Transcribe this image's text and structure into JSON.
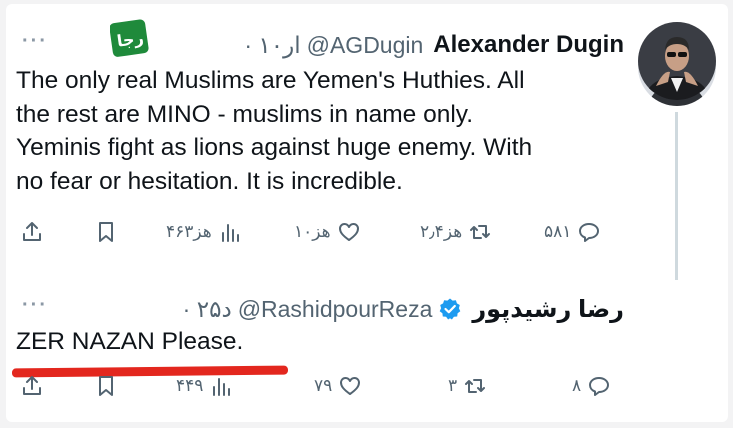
{
  "tweet1": {
    "display_name": "Alexander Dugin",
    "handle": "@AGDugin",
    "time": "· ۱۰ار",
    "body": "The only real Muslims are Yemen's Huthies. All\nthe rest are MINO - muslims in name only.\nYeminis fight as lions against huge enemy. With\nno fear or hesitation. It is incredible.",
    "more_label": "···",
    "badge_text": "رجا",
    "actions": {
      "replies": "۵۸۱",
      "reposts": "۲٫۴هز",
      "likes": "۱۰هز",
      "views": "۴۶۳هز"
    }
  },
  "tweet2": {
    "display_name": "رضا رشیدپور",
    "handle": "@RashidpourReza",
    "time": "· ۲۵د",
    "body": "ZER NAZAN Please.",
    "more_label": "···",
    "actions": {
      "replies": "۸",
      "reposts": "۳",
      "likes": "۷۹",
      "views": "۴۴۹"
    }
  },
  "colors": {
    "text": "#0f1419",
    "muted": "#536471",
    "verified": "#1d9bf0",
    "underline": "#e3271e",
    "badge": "#1f8a3b"
  },
  "icons": [
    "share-icon",
    "bookmark-icon",
    "views-icon",
    "like-icon",
    "repost-icon",
    "reply-icon",
    "verified-icon",
    "more-icon"
  ]
}
